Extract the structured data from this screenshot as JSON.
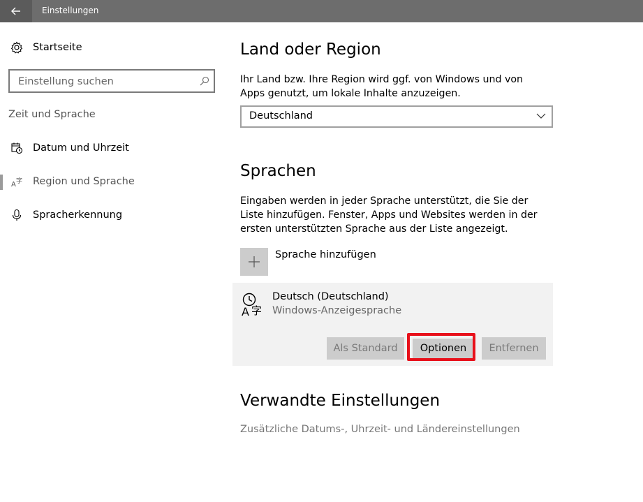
{
  "window": {
    "title": "Einstellungen"
  },
  "sidebar": {
    "home_label": "Startseite",
    "search_placeholder": "Einstellung suchen",
    "section_label": "Zeit und Sprache",
    "items": [
      {
        "label": "Datum und Uhrzeit",
        "icon": "calendar-clock-icon"
      },
      {
        "label": "Region und Sprache",
        "icon": "region-language-icon",
        "active": true
      },
      {
        "label": "Spracherkennung",
        "icon": "microphone-icon"
      }
    ]
  },
  "main": {
    "region": {
      "heading": "Land oder Region",
      "description": "Ihr Land bzw. Ihre Region wird ggf. von Windows und von Apps genutzt, um lokale Inhalte anzuzeigen.",
      "selected": "Deutschland"
    },
    "languages": {
      "heading": "Sprachen",
      "description": "Eingaben werden in jeder Sprache unterstützt, die Sie der Liste hinzufügen. Fenster, Apps und Websites werden in der ersten unterstützten Sprache aus der Liste angezeigt.",
      "add_label": "Sprache hinzufügen",
      "entries": [
        {
          "name": "Deutsch (Deutschland)",
          "subtitle": "Windows-Anzeigesprache",
          "buttons": {
            "set_default": "Als Standard",
            "options": "Optionen",
            "remove": "Entfernen"
          }
        }
      ]
    },
    "related": {
      "heading": "Verwandte Einstellungen",
      "link": "Zusätzliche Datums-, Uhrzeit- und Ländereinstellungen"
    }
  },
  "colors": {
    "titlebar": "#6d6d6d",
    "highlight": "#e8101a",
    "button_gray": "#cccccc",
    "card_bg": "#f2f2f2"
  }
}
